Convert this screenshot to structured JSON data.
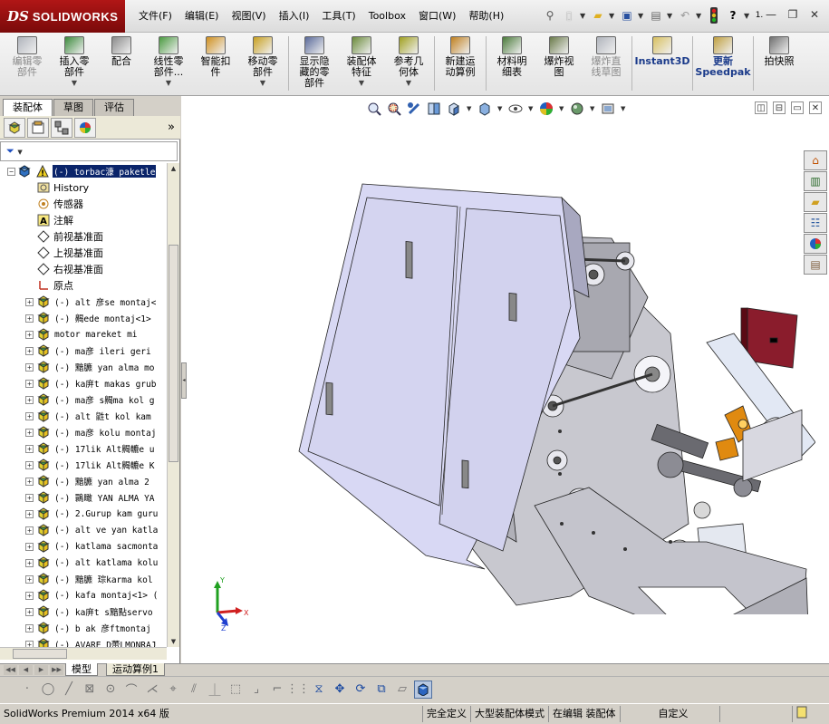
{
  "app": {
    "brand_prefix": "DS",
    "brand_name": "SOLIDWORKS"
  },
  "menu": [
    {
      "label": "文件(F)"
    },
    {
      "label": "编辑(E)"
    },
    {
      "label": "视图(V)"
    },
    {
      "label": "插入(I)"
    },
    {
      "label": "工具(T)"
    },
    {
      "label": "Toolbox"
    },
    {
      "label": "窗口(W)"
    },
    {
      "label": "帮助(H)"
    }
  ],
  "title_tools": [
    {
      "icon": "pushpin-icon",
      "glyph": "⚲"
    },
    {
      "icon": "new-document-icon",
      "glyph": "🗋"
    },
    {
      "icon": "open-folder-icon",
      "glyph": "📂"
    },
    {
      "icon": "save-icon",
      "glyph": "💾"
    },
    {
      "icon": "print-icon",
      "glyph": "🖶"
    },
    {
      "icon": "undo-icon",
      "glyph": "↶"
    },
    {
      "icon": "rebuild-traffic-light-icon",
      "glyph": "🚦"
    },
    {
      "icon": "help-icon",
      "glyph": "?"
    }
  ],
  "help_suffix": "1.",
  "window_controls": {
    "minimize": "—",
    "restore": "❐",
    "close": "✕"
  },
  "ribbon": [
    {
      "name": "edit-component-button",
      "label": "编辑零\n部件",
      "disabled": true,
      "dropdown": false,
      "color": "#b0b4bc"
    },
    {
      "name": "insert-components-button",
      "label": "插入零\n部件",
      "disabled": false,
      "dropdown": true,
      "color": "#3c8a3c"
    },
    {
      "name": "mate-button",
      "label": "配合",
      "disabled": false,
      "dropdown": false,
      "color": "#8a8a8a"
    },
    {
      "name": "linear-pattern-button",
      "label": "线性零\n部件...",
      "disabled": false,
      "dropdown": true,
      "color": "#4a9a40"
    },
    {
      "name": "smart-fasteners-button",
      "label": "智能扣\n件",
      "disabled": false,
      "dropdown": false,
      "color": "#d09020"
    },
    {
      "name": "move-component-button",
      "label": "移动零\n部件",
      "disabled": false,
      "dropdown": true,
      "color": "#c8a020"
    },
    {
      "name": "show-hidden-components-button",
      "label": "显示隐\n藏的零\n部件",
      "disabled": false,
      "dropdown": false,
      "color": "#5a6a9a"
    },
    {
      "name": "assembly-features-button",
      "label": "装配体\n特征",
      "disabled": false,
      "dropdown": true,
      "color": "#6a8a3a"
    },
    {
      "name": "reference-geometry-button",
      "label": "参考几\n何体",
      "disabled": false,
      "dropdown": true,
      "color": "#a0a020"
    },
    {
      "name": "new-motion-study-button",
      "label": "新建运\n动算例",
      "disabled": false,
      "dropdown": false,
      "color": "#c08020"
    },
    {
      "name": "bill-of-materials-button",
      "label": "材料明\n细表",
      "disabled": false,
      "dropdown": false,
      "color": "#4a7a3a"
    },
    {
      "name": "exploded-view-button",
      "label": "爆炸视\n图",
      "disabled": false,
      "dropdown": false,
      "color": "#6a7a4a"
    },
    {
      "name": "explode-line-sketch-button",
      "label": "爆炸直\n线草图",
      "disabled": true,
      "dropdown": false,
      "color": "#b0b4bc"
    },
    {
      "name": "instant3d-button",
      "label": "Instant3D",
      "disabled": false,
      "dropdown": false,
      "color": "#d8c060"
    },
    {
      "name": "update-speedpak-button",
      "label": "更新\nSpeedpak",
      "disabled": false,
      "dropdown": false,
      "color": "#c0a040"
    },
    {
      "name": "take-snapshot-button",
      "label": "拍快照",
      "disabled": false,
      "dropdown": false,
      "color": "#707070"
    }
  ],
  "left_tabs": [
    {
      "label": "装配体"
    },
    {
      "label": "草图"
    },
    {
      "label": "评估"
    }
  ],
  "panel_expand": "»",
  "filter_label": "▼",
  "tree": {
    "root": {
      "label": "(-) torbac漮 paketle"
    },
    "sub_items": [
      {
        "label": "History",
        "icon": "history-icon"
      },
      {
        "label": "传感器",
        "icon": "sensors-icon"
      },
      {
        "label": "注解",
        "icon": "annotations-icon"
      },
      {
        "label": "前视基准面",
        "icon": "plane-icon"
      },
      {
        "label": "上视基准面",
        "icon": "plane-icon"
      },
      {
        "label": "右视基准面",
        "icon": "plane-icon"
      },
      {
        "label": "原点",
        "icon": "origin-icon"
      }
    ],
    "components": [
      {
        "label": "(-) alt 彦se montaj<"
      },
      {
        "label": "(-) 齃ede montaj<1>"
      },
      {
        "label": "motor mareket mi"
      },
      {
        "label": "(-) ma彦 ileri geri"
      },
      {
        "label": "(-) 黯臕 yan alma mo"
      },
      {
        "label": "(-) ka庰t makas grub"
      },
      {
        "label": "(-) ma彦 s齃ma kol g"
      },
      {
        "label": "(-) alt 鼪t kol kam"
      },
      {
        "label": "(-) ma彦 kolu montaj"
      },
      {
        "label": "(-) 17lik Alt齃轆e u"
      },
      {
        "label": "(-) 17lik Alt齃轆e K"
      },
      {
        "label": "(-) 黯臕 yan alma 2"
      },
      {
        "label": "(-) 䴉瞰 YAN ALMA YA"
      },
      {
        "label": "(-) 2.Gurup kam guru"
      },
      {
        "label": "(-) alt ve yan katla"
      },
      {
        "label": "(-) katlama sacmonta"
      },
      {
        "label": "(-) alt katlama kolu"
      },
      {
        "label": "(-) 黯臕 琮karma kol"
      },
      {
        "label": "(-) kafa montaj<1> ("
      },
      {
        "label": "(-) ka庰t s黯點servo"
      },
      {
        "label": "(-) b  ak 彦ftmontaj"
      },
      {
        "label": "(-) AVARE D蕾LMONRAJ"
      }
    ]
  },
  "bottom_tabs": [
    {
      "label": "模型"
    },
    {
      "label": "运动算例1"
    }
  ],
  "status": {
    "product": "SolidWorks Premium 2014 x64 版",
    "definition": "完全定义",
    "mode": "大型装配体模式",
    "editing": "在编辑 装配体",
    "units": "自定义"
  },
  "triad": {
    "x": "X",
    "y": "Y",
    "z": "Z"
  },
  "colors": {
    "cabinet": "#d8d8f4",
    "frame": "#c9c9cf",
    "dark_frame": "#8c8c94",
    "red_box": "#8a1c2c",
    "orange": "#e08a10"
  }
}
